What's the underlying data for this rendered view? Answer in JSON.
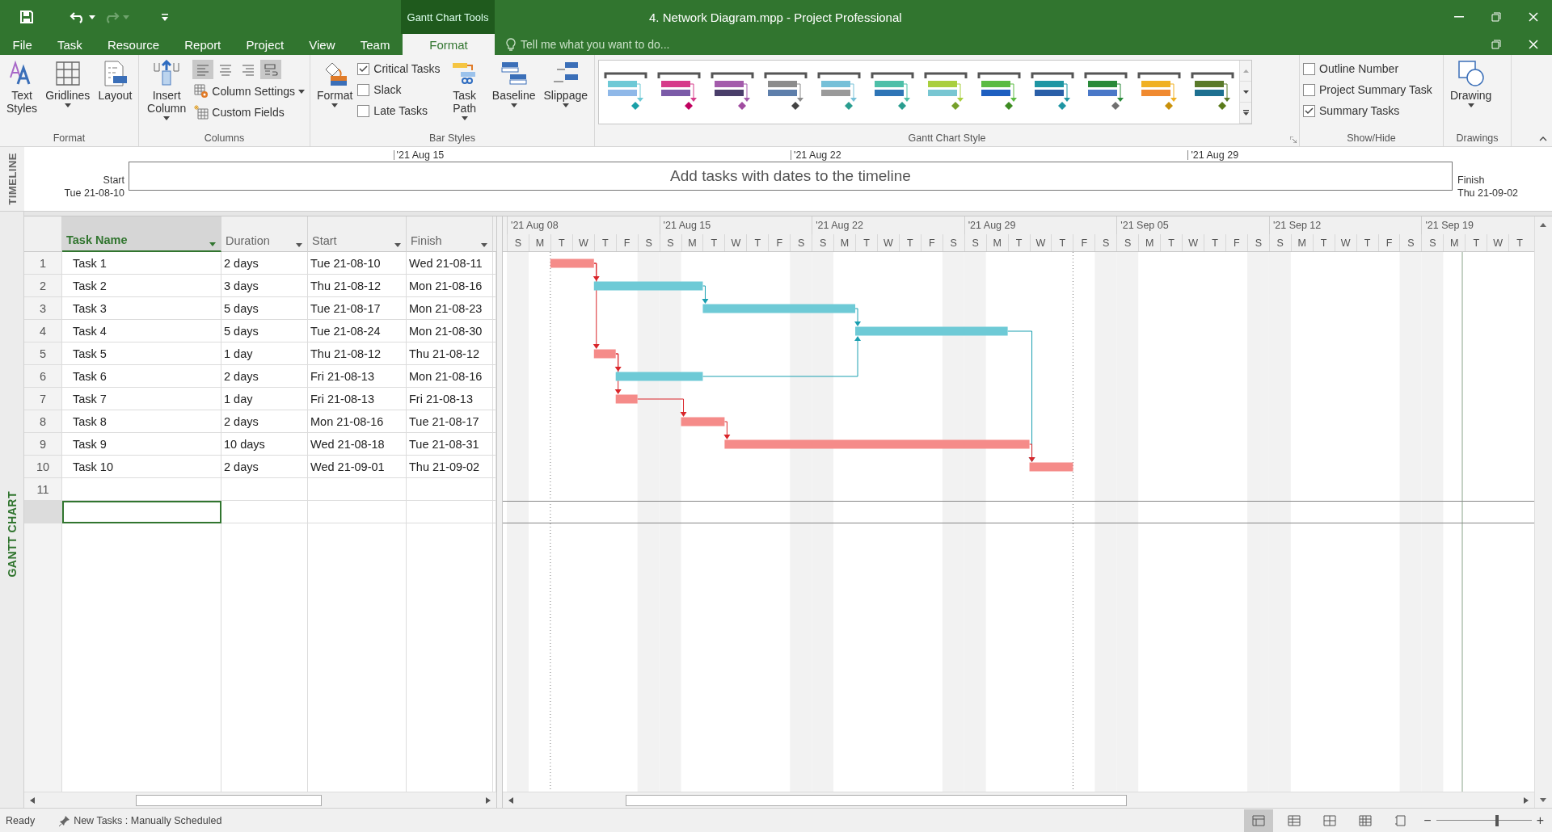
{
  "window": {
    "title": "4. Network Diagram.mpp - Project Professional",
    "context_tab_group": "Gantt Chart Tools"
  },
  "quick_access": {
    "redo": {
      "disabled": true
    }
  },
  "tabs": [
    {
      "label": "File",
      "selected": false
    },
    {
      "label": "Task",
      "selected": false
    },
    {
      "label": "Resource",
      "selected": false
    },
    {
      "label": "Report",
      "selected": false
    },
    {
      "label": "Project",
      "selected": false
    },
    {
      "label": "View",
      "selected": false
    },
    {
      "label": "Team",
      "selected": false
    },
    {
      "label": "Format",
      "selected": true
    }
  ],
  "tell_me": {
    "placeholder": "Tell me what you want to do..."
  },
  "ribbon": {
    "groups": [
      {
        "label": "Format",
        "items": [
          {
            "kind": "large",
            "label": "Text Styles",
            "dropdown": false
          },
          {
            "kind": "large",
            "label": "Gridlines",
            "dropdown": true
          },
          {
            "kind": "large",
            "label": "Layout",
            "dropdown": false
          }
        ]
      },
      {
        "label": "Columns",
        "items": [
          {
            "kind": "large",
            "label": "Insert Column",
            "dropdown": true
          },
          {
            "kind": "align",
            "buttons": [
              {
                "selected": true
              },
              {
                "selected": false
              },
              {
                "selected": false
              },
              {
                "selected": true
              }
            ]
          },
          {
            "kind": "small",
            "label": "Column Settings",
            "dropdown": true
          },
          {
            "kind": "small",
            "label": "Custom Fields",
            "dropdown": false
          }
        ]
      },
      {
        "label": "Bar Styles",
        "items": [
          {
            "kind": "large",
            "label": "Format",
            "dropdown": true
          },
          {
            "kind": "check",
            "label": "Critical Tasks",
            "checked": true
          },
          {
            "kind": "check",
            "label": "Slack",
            "checked": false
          },
          {
            "kind": "check",
            "label": "Late Tasks",
            "checked": false
          },
          {
            "kind": "large",
            "label": "Task Path",
            "dropdown": true
          },
          {
            "kind": "large",
            "label": "Baseline",
            "dropdown": true
          },
          {
            "kind": "large",
            "label": "Slippage",
            "dropdown": true
          }
        ]
      },
      {
        "label": "Gantt Chart Style",
        "items": [
          {
            "kind": "gallery",
            "styles": [
              {
                "bars": [
                  {
                    "color": "#6ec9d6"
                  },
                  {
                    "color": "#8fb8e8"
                  }
                ],
                "milestone": {
                  "color": "#1aa0a8"
                }
              },
              {
                "bars": [
                  {
                    "color": "#d63b8a"
                  },
                  {
                    "color": "#7b5ba8"
                  }
                ],
                "milestone": {
                  "color": "#c0005f"
                }
              },
              {
                "bars": [
                  {
                    "color": "#a35bab"
                  },
                  {
                    "color": "#4a3e6a"
                  }
                ],
                "milestone": {
                  "color": "#a04ca0"
                }
              },
              {
                "bars": [
                  {
                    "color": "#8c8c8c"
                  },
                  {
                    "color": "#5e7fab"
                  }
                ],
                "milestone": {
                  "color": "#444444"
                }
              },
              {
                "bars": [
                  {
                    "color": "#76c0d8"
                  },
                  {
                    "color": "#9a9a9a"
                  }
                ],
                "milestone": {
                  "color": "#2a9d8f"
                }
              },
              {
                "bars": [
                  {
                    "color": "#4dbfa8"
                  },
                  {
                    "color": "#2e75b6"
                  }
                ],
                "milestone": {
                  "color": "#2a9d8f"
                }
              },
              {
                "bars": [
                  {
                    "color": "#a9cf3f"
                  },
                  {
                    "color": "#78c6d2"
                  }
                ],
                "milestone": {
                  "color": "#76a02a"
                }
              },
              {
                "bars": [
                  {
                    "color": "#5bbb43"
                  },
                  {
                    "color": "#1e5fc0"
                  }
                ],
                "milestone": {
                  "color": "#3d8b22"
                }
              },
              {
                "bars": [
                  {
                    "color": "#1e95a3"
                  },
                  {
                    "color": "#2a5fa8"
                  }
                ],
                "milestone": {
                  "color": "#1e95a3"
                }
              },
              {
                "bars": [
                  {
                    "color": "#2a8a3a"
                  },
                  {
                    "color": "#4a78c8"
                  }
                ],
                "milestone": {
                  "color": "#707070"
                }
              },
              {
                "bars": [
                  {
                    "color": "#f0b022"
                  },
                  {
                    "color": "#f08a30"
                  }
                ],
                "milestone": {
                  "color": "#c8900a"
                }
              },
              {
                "bars": [
                  {
                    "color": "#5a7a2a"
                  },
                  {
                    "color": "#1e7090"
                  }
                ],
                "milestone": {
                  "color": "#5a7a1a"
                }
              }
            ]
          }
        ]
      },
      {
        "label": "Show/Hide",
        "items": [
          {
            "kind": "check",
            "label": "Outline Number",
            "checked": false
          },
          {
            "kind": "check",
            "label": "Project Summary Task",
            "checked": false
          },
          {
            "kind": "check",
            "label": "Summary Tasks",
            "checked": true
          }
        ]
      },
      {
        "label": "Drawings",
        "items": [
          {
            "kind": "large",
            "label": "Drawing",
            "dropdown": true
          }
        ]
      }
    ]
  },
  "timeline": {
    "label": "TIMELINE",
    "start_label": "Start",
    "start": "Tue 21-08-10",
    "finish_label": "Finish",
    "finish": "Thu 21-09-02",
    "ticks": [
      "'21 Aug 15",
      "'21 Aug 22",
      "'21 Aug 29"
    ],
    "placeholder": "Add tasks with dates to the timeline"
  },
  "view_bar": {
    "label": "GANTT CHART"
  },
  "table": {
    "columns": [
      {
        "label": "Task Name",
        "selected": true
      },
      {
        "label": "Duration",
        "selected": false
      },
      {
        "label": "Start",
        "selected": false
      },
      {
        "label": "Finish",
        "selected": false
      }
    ],
    "rows": [
      {
        "number": "1",
        "name": "Task 1",
        "duration": "2 days",
        "start": "Tue 21-08-10",
        "finish": "Wed 21-08-11",
        "critical": true,
        "selected": false
      },
      {
        "number": "2",
        "name": "Task 2",
        "duration": "3 days",
        "start": "Thu 21-08-12",
        "finish": "Mon 21-08-16",
        "critical": false,
        "selected": false
      },
      {
        "number": "3",
        "name": "Task 3",
        "duration": "5 days",
        "start": "Tue 21-08-17",
        "finish": "Mon 21-08-23",
        "critical": false,
        "selected": false
      },
      {
        "number": "4",
        "name": "Task 4",
        "duration": "5 days",
        "start": "Tue 21-08-24",
        "finish": "Mon 21-08-30",
        "critical": false,
        "selected": false
      },
      {
        "number": "5",
        "name": "Task 5",
        "duration": "1 day",
        "start": "Thu 21-08-12",
        "finish": "Thu 21-08-12",
        "critical": true,
        "selected": false
      },
      {
        "number": "6",
        "name": "Task 6",
        "duration": "2 days",
        "start": "Fri 21-08-13",
        "finish": "Mon 21-08-16",
        "critical": false,
        "selected": false
      },
      {
        "number": "7",
        "name": "Task 7",
        "duration": "1 day",
        "start": "Fri 21-08-13",
        "finish": "Fri 21-08-13",
        "critical": true,
        "selected": false
      },
      {
        "number": "8",
        "name": "Task 8",
        "duration": "2 days",
        "start": "Mon 21-08-16",
        "finish": "Tue 21-08-17",
        "critical": true,
        "selected": false
      },
      {
        "number": "9",
        "name": "Task 9",
        "duration": "10 days",
        "start": "Wed 21-08-18",
        "finish": "Tue 21-08-31",
        "critical": true,
        "selected": false
      },
      {
        "number": "10",
        "name": "Task 10",
        "duration": "2 days",
        "start": "Wed 21-09-01",
        "finish": "Thu 21-09-02",
        "critical": true,
        "selected": false
      },
      {
        "number": "11",
        "selected": false
      },
      {
        "selected": true
      }
    ]
  },
  "gantt": {
    "weeks": [
      {
        "label": "'21 Aug 08",
        "days": [
          "S",
          "M",
          "T",
          "W",
          "T",
          "F",
          "S"
        ]
      },
      {
        "label": "'21 Aug 15",
        "days": [
          "S",
          "M",
          "T",
          "W",
          "T",
          "F",
          "S"
        ]
      },
      {
        "label": "'21 Aug 22",
        "days": [
          "S",
          "M",
          "T",
          "W",
          "T",
          "F",
          "S"
        ]
      },
      {
        "label": "'21 Aug 29",
        "days": [
          "S",
          "M",
          "T",
          "W",
          "T",
          "F",
          "S"
        ]
      },
      {
        "label": "'21 Sep 05",
        "days": [
          "S",
          "M",
          "T",
          "W",
          "T",
          "F",
          "S"
        ]
      },
      {
        "label": "'21 Sep 12",
        "days": [
          "S",
          "M",
          "T",
          "W",
          "T",
          "F",
          "S"
        ]
      },
      {
        "label": "'21 Sep 19",
        "days": [
          "S",
          "M",
          "T",
          "W",
          "T"
        ]
      }
    ]
  },
  "status_bar": {
    "status": "Ready",
    "new_tasks": "New Tasks : Manually Scheduled",
    "views": [
      {
        "selected": true
      },
      {
        "selected": false
      },
      {
        "selected": false
      },
      {
        "selected": false
      },
      {
        "selected": false
      }
    ],
    "zoom": {
      "minus": "−",
      "plus": "+",
      "level": 0.64
    }
  }
}
